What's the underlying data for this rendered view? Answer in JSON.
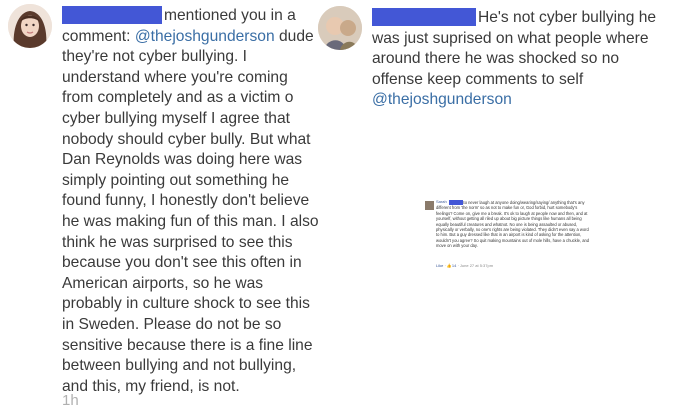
{
  "left_comment": {
    "action": "mentioned you in a comment:",
    "mention": "@thejoshgunderson",
    "body": "dude they're not cyber bullying. I understand where you're coming from completely and as a victim o cyber bullying myself I agree that nobody should cyber bully. But what Dan Reynolds was doing here was simply pointing out something he found funny, I honestly don't believe he was making fun of this man. I also think he was surprised to see this because you don't see this often in American airports, so he was probably in culture shock to see this in Sweden. Please do not be so sensitive because there is a fine line between bullying and not bullying, and this, my friend, is not.",
    "time": "1h"
  },
  "right_comment": {
    "body": "He's not cyber bullying he was just suprised on what people where around there he was shocked so no offense keep comments to self",
    "mention": "@thejoshgunderson"
  },
  "embedded_screenshot": {
    "name": "Sarah",
    "text": "So never laugh at anyone doing/wearing/saying/ anything that's any different from 'the norm' so as not to make fun or, God forbid, hurt somebody's feelings? Come on, give me a break. It's ok to laugh at people now and then, and at yourself, without getting all riled up about big picture things like humans all being equally beautiful creatures and whatnot. No one is being assaulted or abused, physically or verbally, no one's rights are being violated. They didn't even say a word to him. But a guy dressed like that in an airport is kind of asking for the attention, wouldn't you agree? So quit making mountains out of mole hills, have a chuckle, and move on with your day.",
    "like": "Like",
    "likes": "14",
    "date": "June 27 at 5:37pm"
  },
  "colors": {
    "redaction": "#4357d6",
    "mention": "#3a6ea5",
    "time": "#b0b0b0"
  }
}
